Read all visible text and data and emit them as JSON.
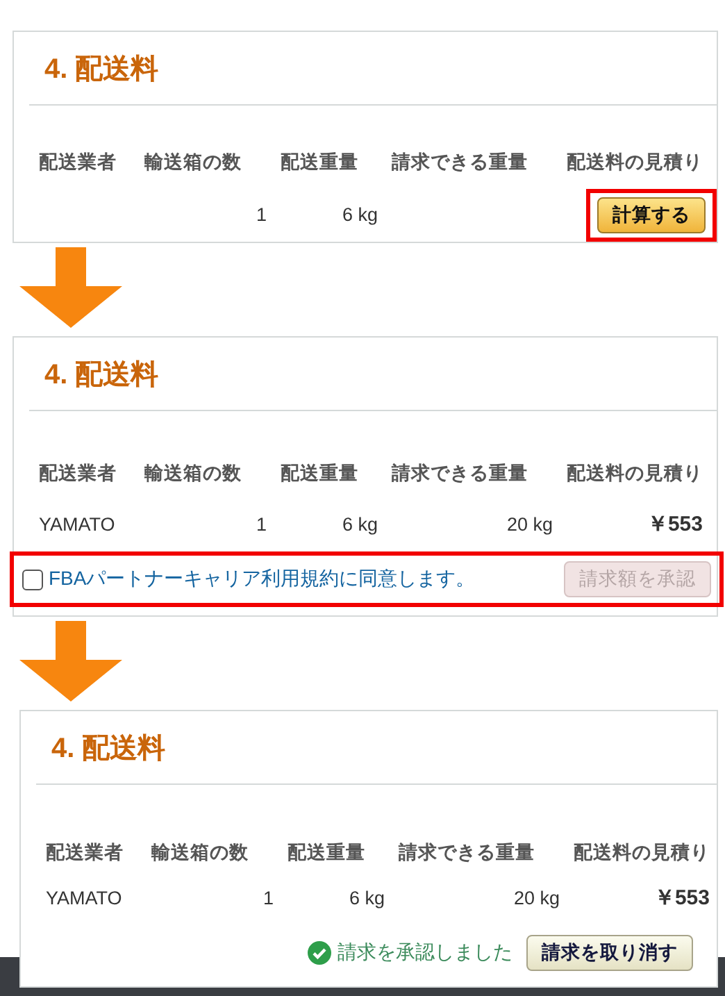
{
  "steps": [
    {
      "title": "4. 配送料",
      "columns": [
        "配送業者",
        "輸送箱の数",
        "配送重量",
        "請求できる重量",
        "配送料の見積り"
      ],
      "row": {
        "boxes": "1",
        "weight": "6 kg"
      },
      "action": {
        "kind": "calculate",
        "button": "計算する",
        "highlighted": true
      }
    },
    {
      "title": "4. 配送料",
      "columns": [
        "配送業者",
        "輸送箱の数",
        "配送重量",
        "請求できる重量",
        "配送料の見積り"
      ],
      "row": {
        "carrier": "YAMATO",
        "boxes": "1",
        "weight": "6 kg",
        "billable_weight": "20 kg",
        "estimate": "￥553"
      },
      "action": {
        "kind": "agreement",
        "label": "FBAパートナーキャリア利用規約に同意します。",
        "checked": false,
        "button": "請求額を承認",
        "disabled": true,
        "highlighted": true
      }
    },
    {
      "title": "4. 配送料",
      "columns": [
        "配送業者",
        "輸送箱の数",
        "配送重量",
        "請求できる重量",
        "配送料の見積り"
      ],
      "row": {
        "carrier": "YAMATO",
        "boxes": "1",
        "weight": "6 kg",
        "billable_weight": "20 kg",
        "estimate": "￥553"
      },
      "action": {
        "kind": "confirmed",
        "status": "請求を承認しました",
        "button": "請求を取り消す"
      }
    }
  ]
}
